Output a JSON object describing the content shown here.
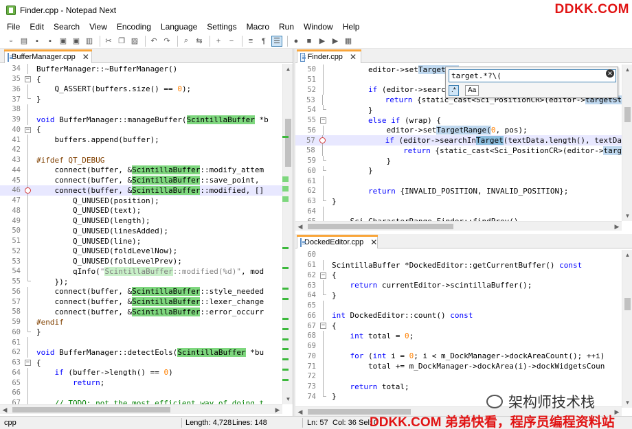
{
  "window": {
    "title": "Finder.cpp - Notepad Next",
    "watermark_top": "DDKK.COM",
    "watermark_bottom": "DDKK.COM 弟弟快看，程序员编程资料站",
    "watermark_wechat": "架构师技术栈"
  },
  "menu": [
    "File",
    "Edit",
    "Search",
    "View",
    "Encoding",
    "Language",
    "Settings",
    "Macro",
    "Run",
    "Window",
    "Help"
  ],
  "toolbar": {
    "buttons": [
      {
        "name": "new-file-icon",
        "glyph": "▫"
      },
      {
        "name": "open-file-icon",
        "glyph": "▤"
      },
      {
        "name": "save-icon",
        "glyph": "▪"
      },
      {
        "name": "save-all-icon",
        "glyph": "▪"
      },
      {
        "name": "close-icon",
        "glyph": "▣"
      },
      {
        "name": "close-all-icon",
        "glyph": "▣"
      },
      {
        "name": "print-icon",
        "glyph": "▥"
      },
      {
        "name": "sep"
      },
      {
        "name": "cut-icon",
        "glyph": "✂"
      },
      {
        "name": "copy-icon",
        "glyph": "❐"
      },
      {
        "name": "paste-icon",
        "glyph": "▨"
      },
      {
        "name": "sep"
      },
      {
        "name": "undo-icon",
        "glyph": "↶"
      },
      {
        "name": "redo-icon",
        "glyph": "↷"
      },
      {
        "name": "sep"
      },
      {
        "name": "find-icon",
        "glyph": "⌕"
      },
      {
        "name": "replace-icon",
        "glyph": "⇆"
      },
      {
        "name": "sep"
      },
      {
        "name": "zoom-in-icon",
        "glyph": "+"
      },
      {
        "name": "zoom-out-icon",
        "glyph": "−"
      },
      {
        "name": "sep"
      },
      {
        "name": "word-wrap-icon",
        "glyph": "≡"
      },
      {
        "name": "show-symbols-icon",
        "glyph": "¶"
      },
      {
        "name": "indent-guide-icon",
        "glyph": "☰",
        "active": true
      },
      {
        "name": "sep"
      },
      {
        "name": "record-macro-icon",
        "glyph": "●"
      },
      {
        "name": "stop-macro-icon",
        "glyph": "■"
      },
      {
        "name": "play-macro-icon",
        "glyph": "▶"
      },
      {
        "name": "play-multiple-icon",
        "glyph": "▶"
      },
      {
        "name": "save-macro-icon",
        "glyph": "▦"
      }
    ]
  },
  "left_pane": {
    "tab": "BufferManager.cpp",
    "lines": [
      {
        "n": "34",
        "code": "BufferManager::~BufferManager()"
      },
      {
        "n": "35",
        "code": "{"
      },
      {
        "n": "36",
        "code": "    Q_ASSERT(buffers.size() == 0);"
      },
      {
        "n": "37",
        "code": "}"
      },
      {
        "n": "38",
        "code": ""
      },
      {
        "n": "39",
        "code": "void BufferManager::manageBuffer(ScintillaBuffer *b"
      },
      {
        "n": "40",
        "code": "{"
      },
      {
        "n": "41",
        "code": "    buffers.append(buffer);"
      },
      {
        "n": "42",
        "code": ""
      },
      {
        "n": "43",
        "code": "#ifdef QT_DEBUG"
      },
      {
        "n": "44",
        "code": "    connect(buffer, &ScintillaBuffer::modify_attem"
      },
      {
        "n": "45",
        "code": "    connect(buffer, &ScintillaBuffer::save_point,"
      },
      {
        "n": "46",
        "code": "    connect(buffer, &ScintillaBuffer::modified, []"
      },
      {
        "n": "47",
        "code": "        Q_UNUSED(position);"
      },
      {
        "n": "48",
        "code": "        Q_UNUSED(text);"
      },
      {
        "n": "49",
        "code": "        Q_UNUSED(length);"
      },
      {
        "n": "50",
        "code": "        Q_UNUSED(linesAdded);"
      },
      {
        "n": "51",
        "code": "        Q_UNUSED(line);"
      },
      {
        "n": "52",
        "code": "        Q_UNUSED(foldLevelNow);"
      },
      {
        "n": "53",
        "code": "        Q_UNUSED(foldLevelPrev);"
      },
      {
        "n": "54",
        "code": "        qInfo(\"ScintillaBuffer::modified(%d)\", mod"
      },
      {
        "n": "55",
        "code": "    });"
      },
      {
        "n": "56",
        "code": "    connect(buffer, &ScintillaBuffer::style_needed"
      },
      {
        "n": "57",
        "code": "    connect(buffer, &ScintillaBuffer::lexer_change"
      },
      {
        "n": "58",
        "code": "    connect(buffer, &ScintillaBuffer::error_occurr"
      },
      {
        "n": "59",
        "code": "#endif"
      },
      {
        "n": "60",
        "code": "}"
      },
      {
        "n": "61",
        "code": ""
      },
      {
        "n": "62",
        "code": "void BufferManager::detectEols(ScintillaBuffer *bu"
      },
      {
        "n": "63",
        "code": "{"
      },
      {
        "n": "64",
        "code": "    if (buffer->length() == 0)"
      },
      {
        "n": "65",
        "code": "        return;"
      },
      {
        "n": "66",
        "code": ""
      },
      {
        "n": "67",
        "code": "    // TODO: not the most efficient way of doing t"
      }
    ]
  },
  "right_top_pane": {
    "tab": "Finder.cpp",
    "lines": [
      {
        "n": "50",
        "code": "        editor->setTargetRan"
      },
      {
        "n": "51",
        "code": ""
      },
      {
        "n": "52",
        "code": "        if (editor->searchIn"
      },
      {
        "n": "53",
        "code": "            return {static_cast<Sci_PositionCR>(editor->targetSt"
      },
      {
        "n": "54",
        "code": "        }"
      },
      {
        "n": "55",
        "code": "        else if (wrap) {"
      },
      {
        "n": "56",
        "code": "            editor->setTargetRange(0, pos);"
      },
      {
        "n": "57",
        "code": "            if (editor->searchInTarget(textData.length(), textDa"
      },
      {
        "n": "58",
        "code": "                return {static_cast<Sci_PositionCR>(editor->targ"
      },
      {
        "n": "59",
        "code": "            }"
      },
      {
        "n": "60",
        "code": "        }"
      },
      {
        "n": "61",
        "code": ""
      },
      {
        "n": "62",
        "code": "        return {INVALID_POSITION, INVALID_POSITION};"
      },
      {
        "n": "63",
        "code": "}"
      },
      {
        "n": "64",
        "code": ""
      },
      {
        "n": "65",
        "code": "    Sci_CharacterRange Finder::findPrev()"
      }
    ],
    "find": {
      "value": "target.*?\\(",
      "regex_label": ".*",
      "case_label": "Aa"
    }
  },
  "right_bottom_pane": {
    "tab": "DockedEditor.cpp",
    "lines": [
      {
        "n": "60",
        "code": ""
      },
      {
        "n": "61",
        "code": "ScintillaBuffer *DockedEditor::getCurrentBuffer() const"
      },
      {
        "n": "62",
        "code": "{"
      },
      {
        "n": "63",
        "code": "    return currentEditor->scintillaBuffer();"
      },
      {
        "n": "64",
        "code": "}"
      },
      {
        "n": "65",
        "code": ""
      },
      {
        "n": "66",
        "code": "int DockedEditor::count() const"
      },
      {
        "n": "67",
        "code": "{"
      },
      {
        "n": "68",
        "code": "    int total = 0;"
      },
      {
        "n": "69",
        "code": ""
      },
      {
        "n": "70",
        "code": "    for (int i = 0; i < m_DockManager->dockAreaCount(); ++i)"
      },
      {
        "n": "71",
        "code": "        total += m_DockManager->dockArea(i)->dockWidgetsCoun"
      },
      {
        "n": "72",
        "code": ""
      },
      {
        "n": "73",
        "code": "    return total;"
      },
      {
        "n": "74",
        "code": "}"
      }
    ]
  },
  "status": {
    "language": "cpp",
    "length": "Length: 4,728",
    "lines": "Lines: 148",
    "ln": "Ln: 57",
    "col": "Col: 36",
    "sel": "Sel: 0"
  },
  "colors": {
    "accent_tab": "#f9a53a",
    "mark_green": "#7ed77e",
    "find_highlight": "#8ebfdf",
    "watermark": "#e11414"
  }
}
